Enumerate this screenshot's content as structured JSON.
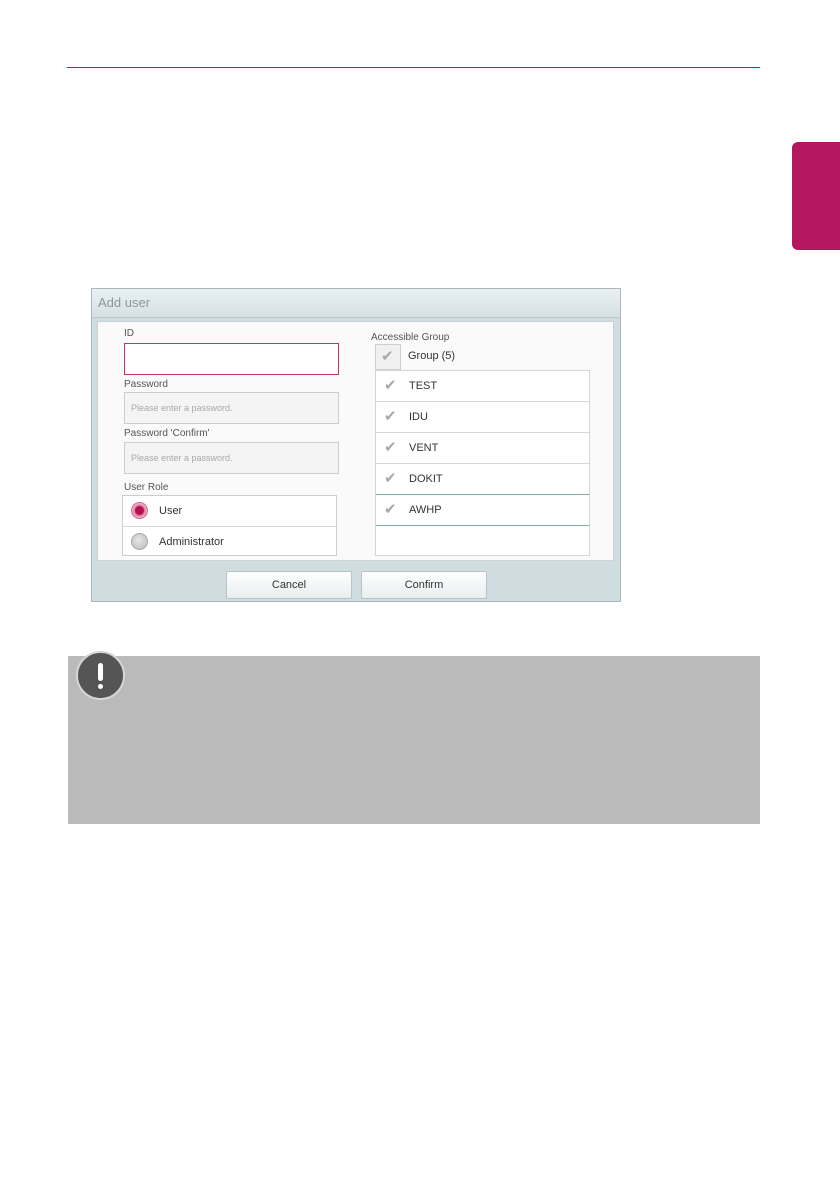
{
  "dialog": {
    "title": "Add user",
    "id_label": "ID",
    "id_value": "",
    "password_label": "Password",
    "password_placeholder": "Please enter a password.",
    "password_confirm_label": "Password 'Confirm'",
    "password_confirm_placeholder": "Please enter a password.",
    "user_role_label": "User Role",
    "roles": [
      {
        "label": "User",
        "selected": true
      },
      {
        "label": "Administrator",
        "selected": false
      }
    ],
    "accessible_group_label": "Accessible Group",
    "group_header": "Group (5)",
    "groups": [
      "TEST",
      "IDU",
      "VENT",
      "DOKIT",
      "AWHP"
    ],
    "cancel_label": "Cancel",
    "confirm_label": "Confirm"
  },
  "colors": {
    "accent": "#b5175f",
    "note_background": "#bababa"
  },
  "icons": {
    "note": "exclamation-icon",
    "check": "checkmark-icon"
  }
}
